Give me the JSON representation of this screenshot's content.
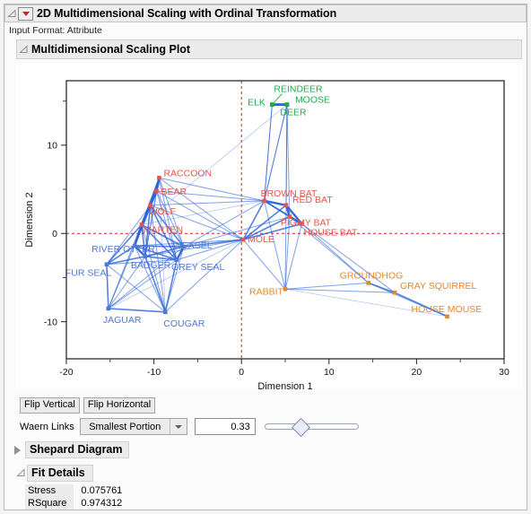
{
  "window": {
    "title": "2D Multidimensional Scaling with Ordinal Transformation",
    "input_format": "Input Format: Attribute",
    "menu_icon": "red-triangle-menu-icon",
    "disclosure_icon": "disclosure-open-icon"
  },
  "plot_section": {
    "title": "Multidimensional Scaling Plot"
  },
  "controls": {
    "flip_vertical": "Flip Vertical",
    "flip_horizontal": "Flip Horizontal",
    "waern_label": "Waern Links",
    "waern_value": "Smallest Portion",
    "waern_options": [
      "Smallest Portion"
    ],
    "threshold_value": "0.33",
    "slider_position_pct": 36
  },
  "shepard": {
    "label": "Shepard Diagram",
    "disclosure_icon": "disclosure-closed-icon"
  },
  "fit_details": {
    "label": "Fit Details",
    "disclosure_icon": "disclosure-open-icon",
    "rows": [
      {
        "name": "Stress",
        "value": "0.075761"
      },
      {
        "name": "RSquare",
        "value": "0.974312"
      }
    ]
  },
  "chart_data": {
    "type": "scatter",
    "title": "Multidimensional Scaling Plot",
    "xlabel": "Dimension 1",
    "ylabel": "Dimension 2",
    "xlim": [
      -20,
      30
    ],
    "ylim": [
      -14.2,
      17.3
    ],
    "xticks": [
      -20,
      -10,
      0,
      10,
      20,
      30
    ],
    "xticks_minor": [
      -15,
      -5,
      5,
      15,
      25
    ],
    "yticks": [
      -10,
      0,
      10
    ],
    "yticks_minor": [
      -5,
      5,
      15
    ],
    "grid": false,
    "legend": false,
    "reference_lines": {
      "x": 0,
      "y": 0,
      "color": "#cc2222",
      "style": "dashed"
    },
    "link_color": "#2b62d9",
    "group_colors": {
      "red": "#e8544a",
      "green": "#22aa4e",
      "blue": "#4e79d6",
      "orange": "#e08a2e"
    },
    "points": [
      {
        "label": "RACCOON",
        "x": -9.4,
        "y": 6.3,
        "group": "red"
      },
      {
        "label": "BEAR",
        "x": -9.7,
        "y": 4.8,
        "group": "red"
      },
      {
        "label": "WOLF",
        "x": -10.4,
        "y": 3.2,
        "group": "red"
      },
      {
        "label": "MARTEN",
        "x": -11.4,
        "y": 1.0,
        "group": "red"
      },
      {
        "label": "BROWN BAT",
        "x": 2.6,
        "y": 3.7,
        "group": "red"
      },
      {
        "label": "RED BAT",
        "x": 5.1,
        "y": 3.2,
        "group": "red"
      },
      {
        "label": "PIGMY BAT",
        "x": 5.5,
        "y": 1.9,
        "group": "red"
      },
      {
        "label": "HOUSE BAT",
        "x": 6.9,
        "y": 1.1,
        "group": "red"
      },
      {
        "label": "MOLE",
        "x": 0.2,
        "y": -0.7,
        "group": "red"
      },
      {
        "label": "REINDEER",
        "x": 3.5,
        "y": 14.6,
        "group": "green"
      },
      {
        "label": "ELK",
        "x": 5.2,
        "y": 14.6,
        "group": "green"
      },
      {
        "label": "MOOSE",
        "x": 5.2,
        "y": 14.6,
        "group": "green"
      },
      {
        "label": "DEER",
        "x": 3.5,
        "y": 14.6,
        "group": "green"
      },
      {
        "label": "RIVER OTTER",
        "x": -12.2,
        "y": -1.4,
        "group": "blue"
      },
      {
        "label": "FUR SEAL",
        "x": -15.4,
        "y": -3.5,
        "group": "blue"
      },
      {
        "label": "BADGER",
        "x": -11.0,
        "y": -2.6,
        "group": "blue"
      },
      {
        "label": "WEASEL",
        "x": -6.6,
        "y": -1.5,
        "group": "blue"
      },
      {
        "label": "GREY SEAL",
        "x": -7.4,
        "y": -3.0,
        "group": "blue"
      },
      {
        "label": "JAGUAR",
        "x": -15.2,
        "y": -8.5,
        "group": "blue"
      },
      {
        "label": "COUGAR",
        "x": -8.7,
        "y": -8.9,
        "group": "blue"
      },
      {
        "label": "RABBIT",
        "x": 5.0,
        "y": -6.3,
        "group": "orange"
      },
      {
        "label": "GROUNDHOG",
        "x": 14.5,
        "y": -5.6,
        "group": "orange"
      },
      {
        "label": "GRAY SQUIRREL",
        "x": 17.5,
        "y": -6.7,
        "group": "orange"
      },
      {
        "label": "HOUSE MOUSE",
        "x": 23.5,
        "y": -9.4,
        "group": "orange"
      }
    ]
  }
}
